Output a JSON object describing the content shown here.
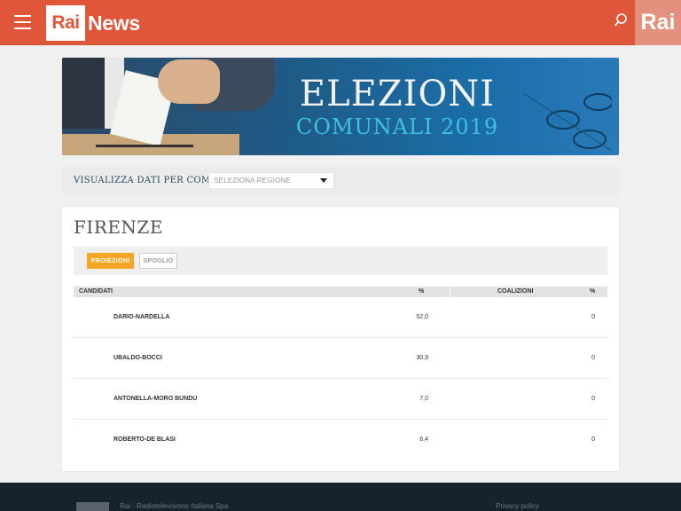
{
  "header": {
    "logo_rai": "Rai",
    "logo_news": "News",
    "brand": "Rai",
    "colors": {
      "bar": "#e0563a",
      "brand_box": "#e4907e"
    }
  },
  "banner": {
    "title": "ELEZIONI",
    "subtitle": "COMUNALI 2019"
  },
  "filter": {
    "label": "VISUALIZZA DATI PER COMUNE",
    "select_value": "SELEZIONA REGIONE"
  },
  "results": {
    "city": "FIRENZE",
    "tabs": [
      {
        "label": "PROIEZIONI",
        "active": true
      },
      {
        "label": "SPOGLIO",
        "active": false
      }
    ],
    "columns": {
      "candidates": "CANDIDATI",
      "pct": "%",
      "coalitions": "COALIZIONI",
      "coalition_pct": "%"
    },
    "rows": [
      {
        "name": "DARIO-NARDELLA",
        "pct": "52,0",
        "coalition_pct": "0"
      },
      {
        "name": "UBALDO-BOCCI",
        "pct": "30,9",
        "coalition_pct": "0"
      },
      {
        "name": "ANTONELLA-MORO BUNDU",
        "pct": "7,0",
        "coalition_pct": "0"
      },
      {
        "name": "ROBERTO-DE BLASI",
        "pct": "6,4",
        "coalition_pct": "0"
      }
    ]
  },
  "footer": {
    "company": "Rai - Radiotelevisione Italiana Spa",
    "privacy": "Privacy policy"
  }
}
